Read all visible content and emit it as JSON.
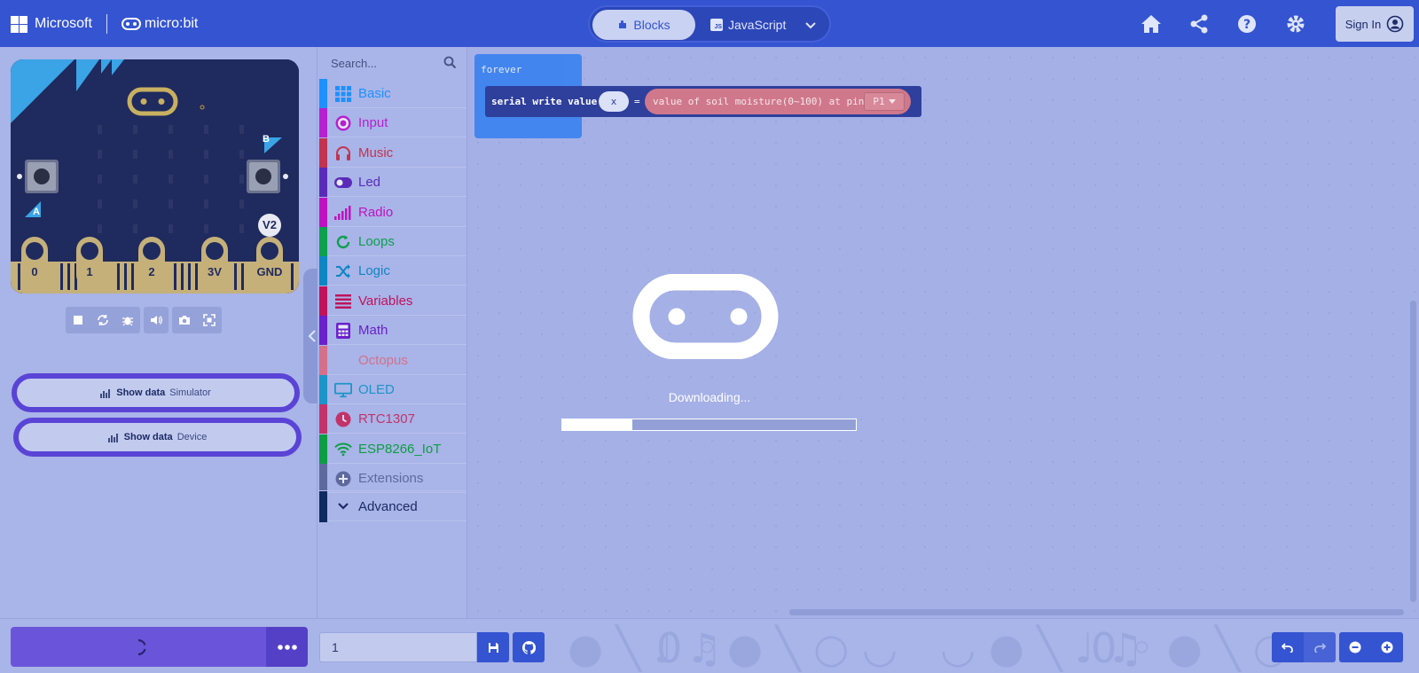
{
  "header": {
    "ms_brand": "Microsoft",
    "product": "micro:bit",
    "tabs": [
      {
        "label": "Blocks",
        "active": true
      },
      {
        "label": "JavaScript",
        "active": false
      }
    ],
    "sign_in": "Sign In",
    "icons": [
      "home-icon",
      "share-icon",
      "help-icon",
      "settings-icon",
      "user-avatar-icon"
    ]
  },
  "simulator": {
    "pins": [
      "0",
      "1",
      "2",
      "3V",
      "GND"
    ],
    "button_a": "A",
    "button_b": "B",
    "version": "V2",
    "controls": [
      "stop-icon",
      "restart-icon",
      "debug-icon",
      "mute-icon",
      "screenshot-icon",
      "fullscreen-icon"
    ],
    "show_data_simulator": {
      "label": "Show data",
      "sub": "Simulator"
    },
    "show_data_device": {
      "label": "Show data",
      "sub": "Device"
    }
  },
  "toolbox": {
    "search_placeholder": "Search...",
    "categories": [
      {
        "label": "Basic",
        "color": "#1e90ff",
        "icon": "grid-icon"
      },
      {
        "label": "Input",
        "color": "#b620d0",
        "icon": "radio-target-icon"
      },
      {
        "label": "Music",
        "color": "#c2334f",
        "icon": "headphones-icon"
      },
      {
        "label": "Led",
        "color": "#5a2bb8",
        "icon": "toggle-icon"
      },
      {
        "label": "Radio",
        "color": "#c012c0",
        "icon": "signal-bars-icon"
      },
      {
        "label": "Loops",
        "color": "#0ca14c",
        "icon": "loop-icon"
      },
      {
        "label": "Logic",
        "color": "#0e86c2",
        "icon": "shuffle-icon"
      },
      {
        "label": "Variables",
        "color": "#c0135b",
        "icon": "list-lines-icon"
      },
      {
        "label": "Math",
        "color": "#6a20cc",
        "icon": "calculator-icon"
      },
      {
        "label": "Octopus",
        "color": "#d5708a",
        "icon": ""
      },
      {
        "label": "OLED",
        "color": "#1c95c9",
        "icon": "monitor-icon"
      },
      {
        "label": "RTC1307",
        "color": "#c2336a",
        "icon": "clock-icon"
      },
      {
        "label": "ESP8266_IoT",
        "color": "#0c9e42",
        "icon": "wifi-icon"
      },
      {
        "label": "Extensions",
        "color": "#5e6a9e",
        "icon": "plus-circle-icon"
      }
    ],
    "advanced": {
      "label": "Advanced",
      "color": "#0f2a5e",
      "icon": "chevron-down-icon"
    }
  },
  "workspace": {
    "forever_label": "forever",
    "serial_label": "serial write value",
    "var_name": "x",
    "equals": "=",
    "soil_label": "value of soil moisture(0~100) at pin",
    "pin_value": "P1"
  },
  "loader": {
    "text": "Downloading...",
    "progress_percent": 24
  },
  "footer": {
    "project_name": "1",
    "icons": [
      "spinner-icon",
      "more-icon",
      "save-icon",
      "github-icon",
      "undo-icon",
      "redo-icon",
      "zoom-out-icon",
      "zoom-in-icon"
    ]
  }
}
